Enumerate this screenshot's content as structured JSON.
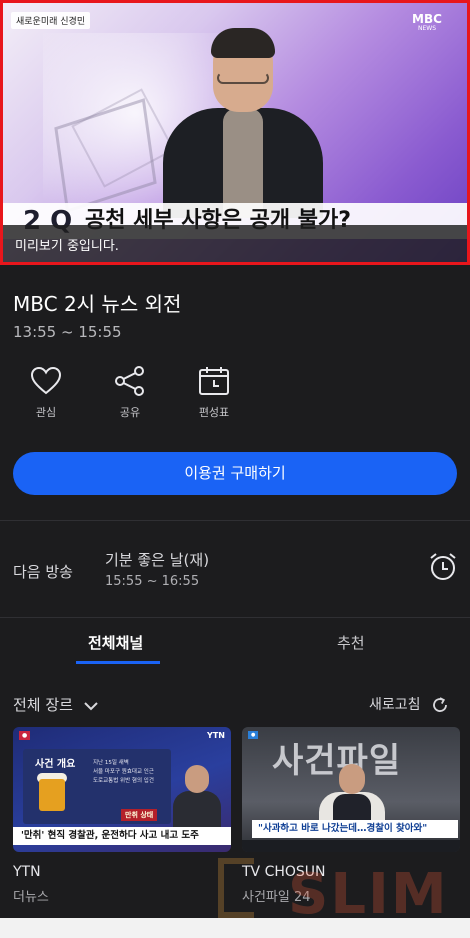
{
  "player": {
    "show_tag": "새로운미래 신경민",
    "channel_logo": "MBC",
    "channel_logo_sub": "NEWS",
    "headline_number": "2 Q",
    "headline": "공천 세부 사항은 공개 불가?",
    "preview_notice": "미리보기 중입니다.",
    "border_color": "#e8161c"
  },
  "program": {
    "title": "MBC 2시 뉴스 외전",
    "time": "13:55 ~ 15:55"
  },
  "actions": [
    {
      "label": "관심",
      "icon": "heart-icon"
    },
    {
      "label": "공유",
      "icon": "share-icon"
    },
    {
      "label": "편성표",
      "icon": "calendar-icon"
    }
  ],
  "buy_button": {
    "label": "이용권 구매하기",
    "color": "#1a63f5"
  },
  "next": {
    "label": "다음 방송",
    "title": "기분 좋은 날(재)",
    "time": "15:55 ~ 16:55",
    "icon": "alarm-clock-icon"
  },
  "tabs": [
    {
      "label": "전체채널",
      "active": true
    },
    {
      "label": "추천",
      "active": false
    }
  ],
  "filter": {
    "genre": "전체 장르",
    "refresh": "새로고침"
  },
  "channels": [
    {
      "name": "YTN",
      "program": "더뉴스",
      "thumb": {
        "logo": "YTN",
        "panel_title": "사건 개요",
        "info_1": "지난 15일 새벽",
        "info_2": "서울 마포구 원효대교 인근",
        "info_3": "도로교통법 위반 혐의 입건",
        "stamp": "만취 상태",
        "caption": "'만취' 현직 경찰관, 운전하다 사고 내고 도주"
      }
    },
    {
      "name": "TV CHOSUN",
      "program": "사건파일 24",
      "thumb": {
        "title": "사건파일",
        "caption": "\"사과하고 바로 나갔는데…경찰이 찾아와\""
      }
    }
  ],
  "watermark": "SLIM"
}
